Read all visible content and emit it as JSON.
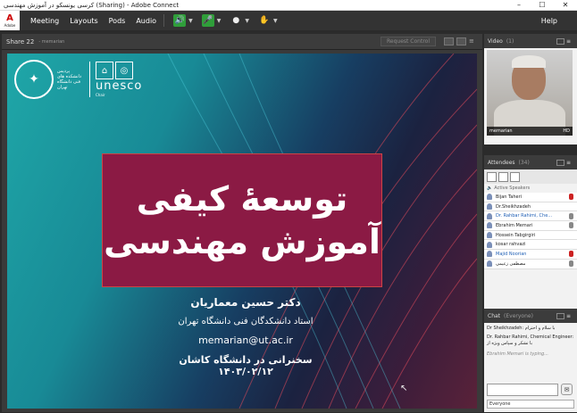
{
  "window": {
    "title": "کرسی یونسکو در آموزش مهندسی (Sharing) - Adobe Connect",
    "minimize": "–",
    "maximize": "☐",
    "close": "✕"
  },
  "menu": {
    "adobe_logo": "A",
    "adobe_text": "Adobe",
    "items": [
      "Meeting",
      "Layouts",
      "Pods",
      "Audio"
    ],
    "help": "Help"
  },
  "toolbar": {
    "icons": [
      "speaker-icon",
      "microphone-icon",
      "camera-icon",
      "hand-raise-icon"
    ]
  },
  "share_pod": {
    "title": "Share 22",
    "subtitle": "- memarian",
    "request_control": "Request Control",
    "slide": {
      "logo_fa": "پردیس دانشکده های فنی دانشگاه تهران",
      "unesco_name": "unesco",
      "unesco_chair": "Chair",
      "title_line1": "توسعهٔ کیفی",
      "title_line2": "آموزش مهندسی",
      "presenter": "دکتر حسین معماریان",
      "position": "استاد دانشکدگان فنی دانشگاه تهران",
      "email": "memarian@ut.ac.ir",
      "talk": "سخنرانی در دانشگاه کاشان ۱۴۰۳/۰۲/۱۲"
    }
  },
  "video_pod": {
    "title": "Video",
    "count": "(1)",
    "caption": "memarian",
    "quality": "HD"
  },
  "attendees_pod": {
    "title": "Attendees",
    "count": "(34)",
    "active_speakers": "Active Speakers",
    "list": [
      {
        "name": "Bijan Taheri",
        "host": false
      },
      {
        "name": "Dr.Sheikhzadeh",
        "host": false
      },
      {
        "name": "Dr. Rahbar Rahimi, Che...",
        "host": true
      },
      {
        "name": "Ebrahim Memari",
        "host": false
      },
      {
        "name": "Hossein Tabgirgiri",
        "host": false
      },
      {
        "name": "kosar rahvazi",
        "host": false
      },
      {
        "name": "Majid Noorian",
        "host": true
      },
      {
        "name": "مصطفی زعیمی",
        "host": false
      }
    ]
  },
  "chat_pod": {
    "title": "Chat",
    "audience": "(Everyone)",
    "messages": [
      "Dr Sheikhzadeh: با سلام و احترام",
      "Dr. Rahbar Rahimi, Chemical Engineer: با تشکر و سپاس ویژه از",
      "Ebrahim Memari is typing..."
    ],
    "send_to": "Everyone"
  }
}
